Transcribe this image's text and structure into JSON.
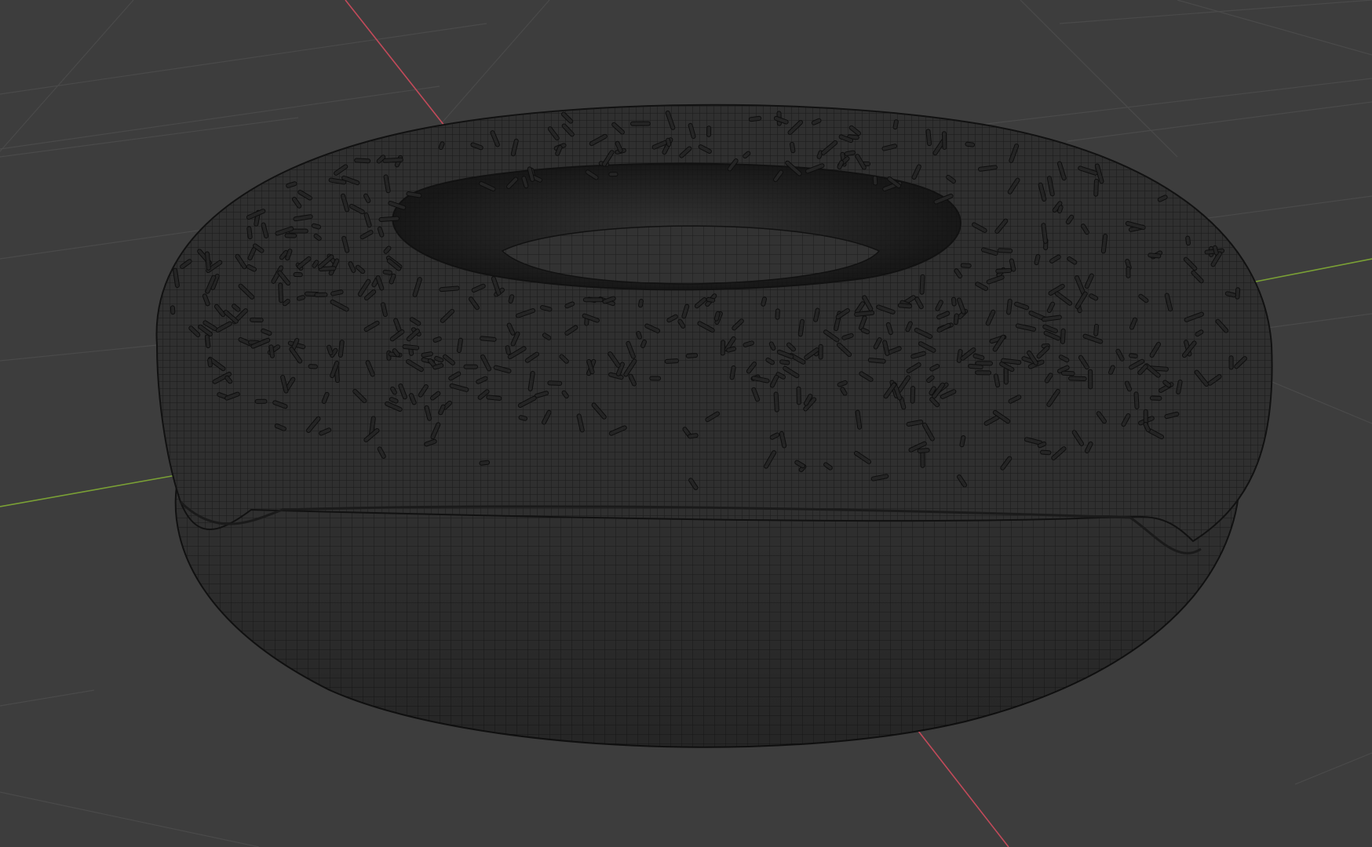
{
  "viewport": {
    "background_color": "#3d3d3d",
    "grid_color": "#4a4a4a",
    "x_axis_color": "#c24a5a",
    "y_axis_color": "#7aa035",
    "mesh": {
      "object": "donut-with-icing-and-sprinkles",
      "shading": "wireframe",
      "fill_color": "#2e2e2e",
      "wire_color": "#151515"
    }
  }
}
